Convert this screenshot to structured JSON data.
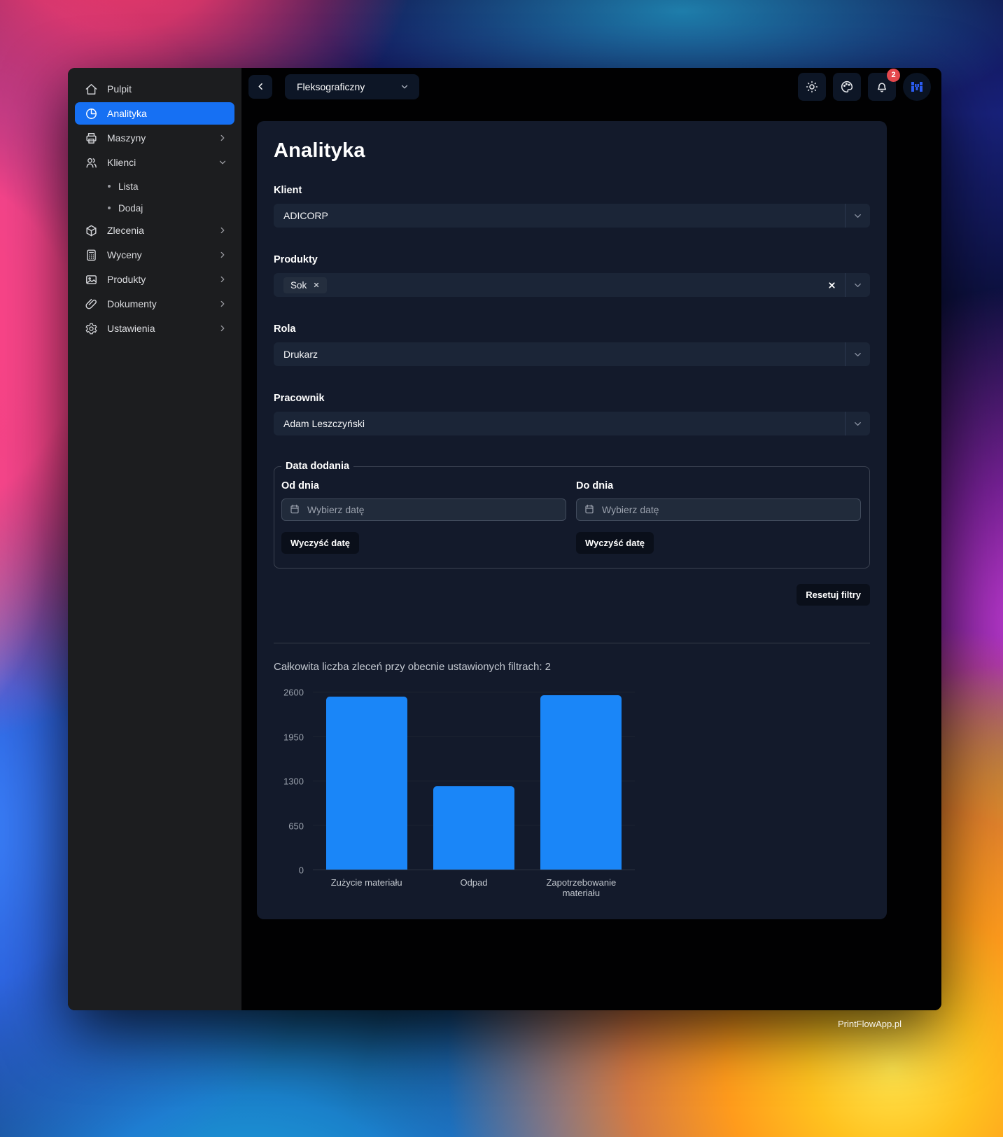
{
  "wallpaper": {
    "watermark": "PrintFlowApp.pl"
  },
  "sidebar": {
    "items": [
      {
        "label": "Pulpit",
        "icon": "home"
      },
      {
        "label": "Analityka",
        "icon": "pie-chart",
        "active": true
      },
      {
        "label": "Maszyny",
        "icon": "printer",
        "chevron": "right"
      },
      {
        "label": "Klienci",
        "icon": "users",
        "chevron": "down",
        "expanded": true,
        "children": [
          {
            "label": "Lista"
          },
          {
            "label": "Dodaj"
          }
        ]
      },
      {
        "label": "Zlecenia",
        "icon": "package",
        "chevron": "right"
      },
      {
        "label": "Wyceny",
        "icon": "calculator",
        "chevron": "right"
      },
      {
        "label": "Produkty",
        "icon": "image",
        "chevron": "right"
      },
      {
        "label": "Dokumenty",
        "icon": "paperclip",
        "chevron": "right"
      },
      {
        "label": "Ustawienia",
        "icon": "gear",
        "chevron": "right"
      }
    ]
  },
  "topbar": {
    "machine_select": {
      "value": "Fleksograficzny"
    },
    "notification_count": "2",
    "icons": [
      "sun",
      "palette",
      "bell",
      "avatar"
    ]
  },
  "page": {
    "title": "Analityka"
  },
  "filters": {
    "klient": {
      "label": "Klient",
      "value": "ADICORP"
    },
    "produkty": {
      "label": "Produkty",
      "chips": [
        {
          "label": "Sok"
        }
      ]
    },
    "rola": {
      "label": "Rola",
      "value": "Drukarz"
    },
    "pracownik": {
      "label": "Pracownik",
      "value": "Adam Leszczyński"
    },
    "data_dodania": {
      "legend": "Data dodania",
      "od": {
        "label": "Od dnia",
        "placeholder": "Wybierz datę",
        "clear_label": "Wyczyść datę"
      },
      "do": {
        "label": "Do dnia",
        "placeholder": "Wybierz datę",
        "clear_label": "Wyczyść datę"
      }
    },
    "reset_label": "Resetuj filtry"
  },
  "chart_section": {
    "summary": "Całkowita liczba zleceń przy obecnie ustawionych filtrach: 2"
  },
  "chart_data": {
    "type": "bar",
    "categories": [
      "Zużycie materiału",
      "Odpad",
      "Zapotrzebowanie materiału"
    ],
    "values": [
      2540,
      1220,
      2560
    ],
    "yticks": [
      0,
      650,
      1300,
      1950,
      2600
    ],
    "ylim": [
      0,
      2600
    ],
    "bar_color": "#1a86f8",
    "grid": true,
    "legend_position": "none",
    "title": "",
    "xlabel": "",
    "ylabel": ""
  },
  "colors": {
    "accent": "#1670f3",
    "bar": "#1a86f8",
    "badge": "#e5484d",
    "card_bg": "#131a2b"
  }
}
